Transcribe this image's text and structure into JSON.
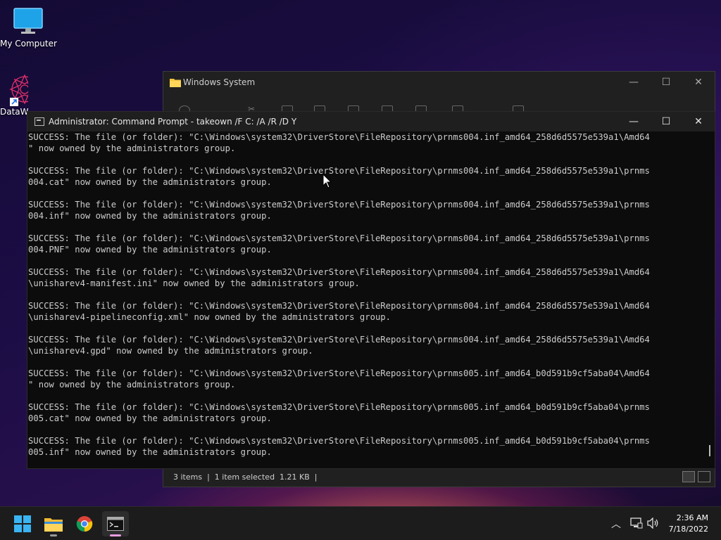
{
  "desktop": {
    "icons": [
      {
        "label": "My Computer"
      },
      {
        "label": "DataW"
      }
    ]
  },
  "explorer": {
    "title": "Windows System",
    "status": "3 items  |  1 item selected  1.21 KB  |"
  },
  "cmd": {
    "title": "Administrator: Command Prompt - takeown  /F C: /A /R /D Y",
    "lines": [
      "SUCCESS: The file (or folder): \"C:\\Windows\\system32\\DriverStore\\FileRepository\\prnms004.inf_amd64_258d6d5575e539a1\\Amd64",
      "\" now owned by the administrators group.",
      "",
      "SUCCESS: The file (or folder): \"C:\\Windows\\system32\\DriverStore\\FileRepository\\prnms004.inf_amd64_258d6d5575e539a1\\prnms",
      "004.cat\" now owned by the administrators group.",
      "",
      "SUCCESS: The file (or folder): \"C:\\Windows\\system32\\DriverStore\\FileRepository\\prnms004.inf_amd64_258d6d5575e539a1\\prnms",
      "004.inf\" now owned by the administrators group.",
      "",
      "SUCCESS: The file (or folder): \"C:\\Windows\\system32\\DriverStore\\FileRepository\\prnms004.inf_amd64_258d6d5575e539a1\\prnms",
      "004.PNF\" now owned by the administrators group.",
      "",
      "SUCCESS: The file (or folder): \"C:\\Windows\\system32\\DriverStore\\FileRepository\\prnms004.inf_amd64_258d6d5575e539a1\\Amd64",
      "\\unisharev4-manifest.ini\" now owned by the administrators group.",
      "",
      "SUCCESS: The file (or folder): \"C:\\Windows\\system32\\DriverStore\\FileRepository\\prnms004.inf_amd64_258d6d5575e539a1\\Amd64",
      "\\unisharev4-pipelineconfig.xml\" now owned by the administrators group.",
      "",
      "SUCCESS: The file (or folder): \"C:\\Windows\\system32\\DriverStore\\FileRepository\\prnms004.inf_amd64_258d6d5575e539a1\\Amd64",
      "\\unisharev4.gpd\" now owned by the administrators group.",
      "",
      "SUCCESS: The file (or folder): \"C:\\Windows\\system32\\DriverStore\\FileRepository\\prnms005.inf_amd64_b0d591b9cf5aba04\\Amd64",
      "\" now owned by the administrators group.",
      "",
      "SUCCESS: The file (or folder): \"C:\\Windows\\system32\\DriverStore\\FileRepository\\prnms005.inf_amd64_b0d591b9cf5aba04\\prnms",
      "005.cat\" now owned by the administrators group.",
      "",
      "SUCCESS: The file (or folder): \"C:\\Windows\\system32\\DriverStore\\FileRepository\\prnms005.inf_amd64_b0d591b9cf5aba04\\prnms",
      "005.inf\" now owned by the administrators group."
    ]
  },
  "taskbar": {
    "apps": [
      "windows-start-icon",
      "file-explorer-icon",
      "chrome-icon",
      "command-prompt-icon"
    ],
    "tray": [
      "chevron-up-icon",
      "network-icon",
      "volume-icon"
    ],
    "time": "2:36 AM",
    "date": "7/18/2022"
  },
  "colors": {
    "console_bg": "#0c0c0c",
    "console_text": "#cccccc",
    "taskbar_bg": "#1c1c1c",
    "active_indicator": "#e79ce0"
  }
}
